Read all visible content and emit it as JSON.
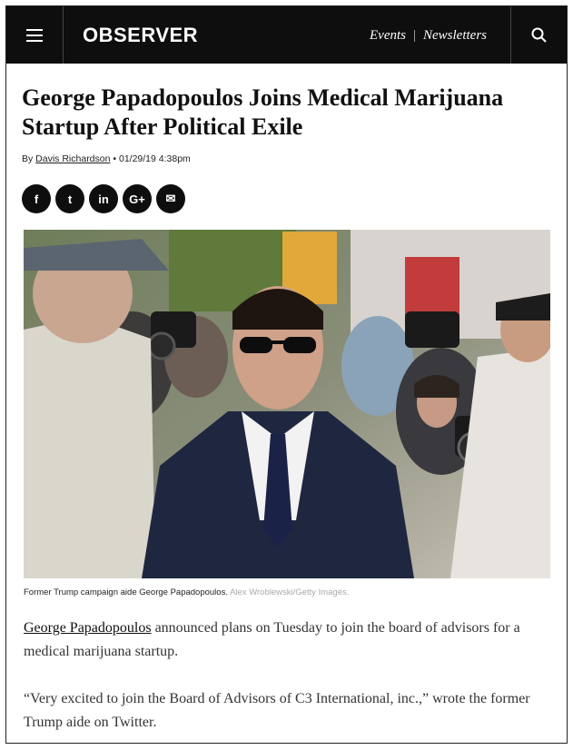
{
  "header": {
    "logo": "OBSERVER",
    "nav_events": "Events",
    "nav_separator": "|",
    "nav_newsletters": "Newsletters",
    "menu_icon": "hamburger-menu-icon",
    "search_icon": "search-icon"
  },
  "article": {
    "headline_line1": "George Papadopoulos Joins Medical Marijuana",
    "headline_line2": "Startup After Political Exile",
    "byline_prefix": "By ",
    "author": "Davis Richardson",
    "byline_date": " • 01/29/19 4:38pm",
    "share": [
      {
        "icon": "facebook-icon",
        "glyph": "f"
      },
      {
        "icon": "twitter-icon",
        "glyph": "t"
      },
      {
        "icon": "linkedin-icon",
        "glyph": "in"
      },
      {
        "icon": "google-plus-icon",
        "glyph": "G+"
      },
      {
        "icon": "email-icon",
        "glyph": "✉"
      }
    ],
    "caption_text": "Former Trump campaign aide George Papadopoulos.",
    "caption_credit": " Alex Wroblewski/Getty Images.",
    "para1_link": "George Papadopoulos",
    "para1_rest": " announced plans on Tuesday to join the board of advisors for a medical marijuana startup.",
    "para2": "“Very excited to join the Board of Advisors of C3 International, inc.,” wrote the former Trump aide on Twitter."
  },
  "colors": {
    "header_bg": "#0e0e0e",
    "text": "#111111",
    "body_text": "#333333",
    "credit": "#aaaaaa"
  }
}
